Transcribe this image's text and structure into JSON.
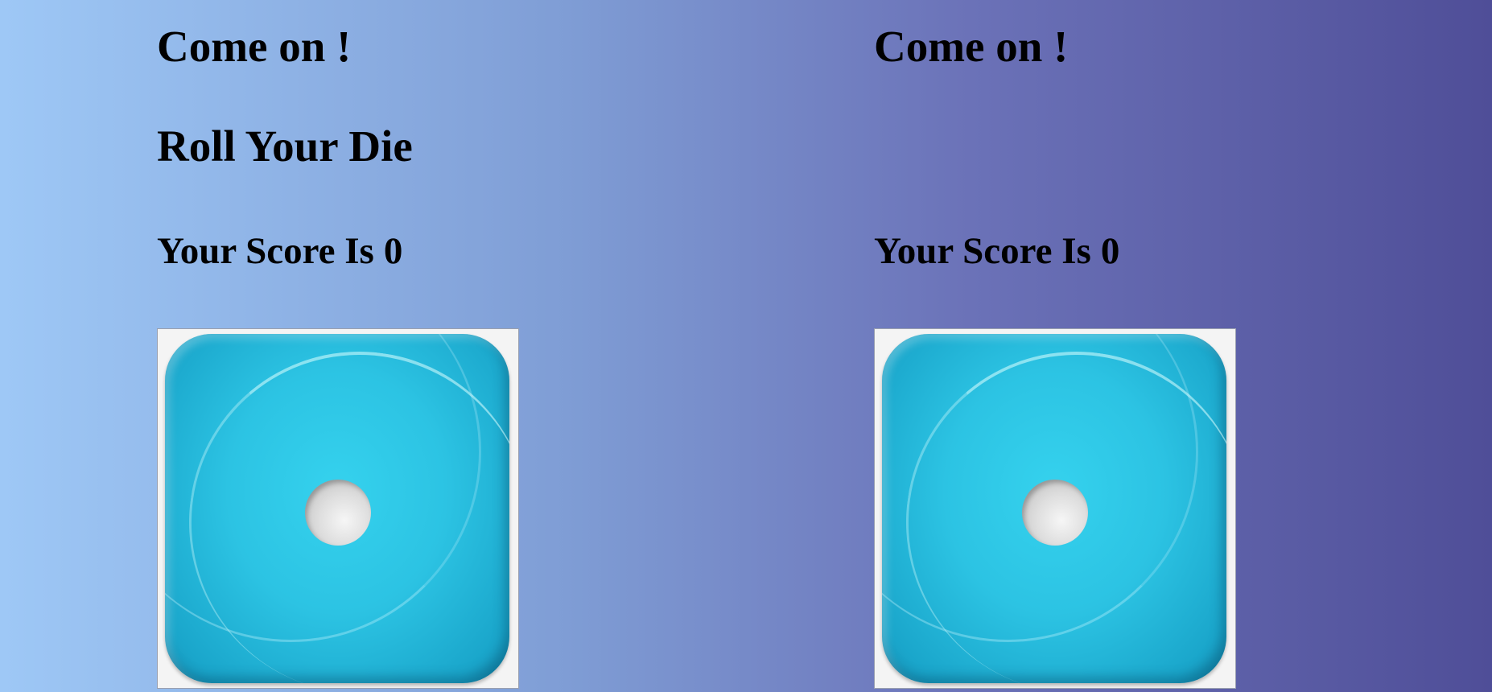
{
  "players": [
    {
      "title": "Come on !",
      "roll_label": "Roll Your Die",
      "score_label": "Your Score Is",
      "score_value": "0",
      "die_value": 1
    },
    {
      "title": "Come on !",
      "roll_label": "",
      "score_label": "Your Score Is",
      "score_value": "0",
      "die_value": 1
    }
  ],
  "colors": {
    "background_start": "#9ec8f6",
    "background_end": "#4f4e98",
    "die_face": "#2cc3e3",
    "pip": "#dedede"
  },
  "icons": {
    "die": "die-face-one-icon"
  }
}
